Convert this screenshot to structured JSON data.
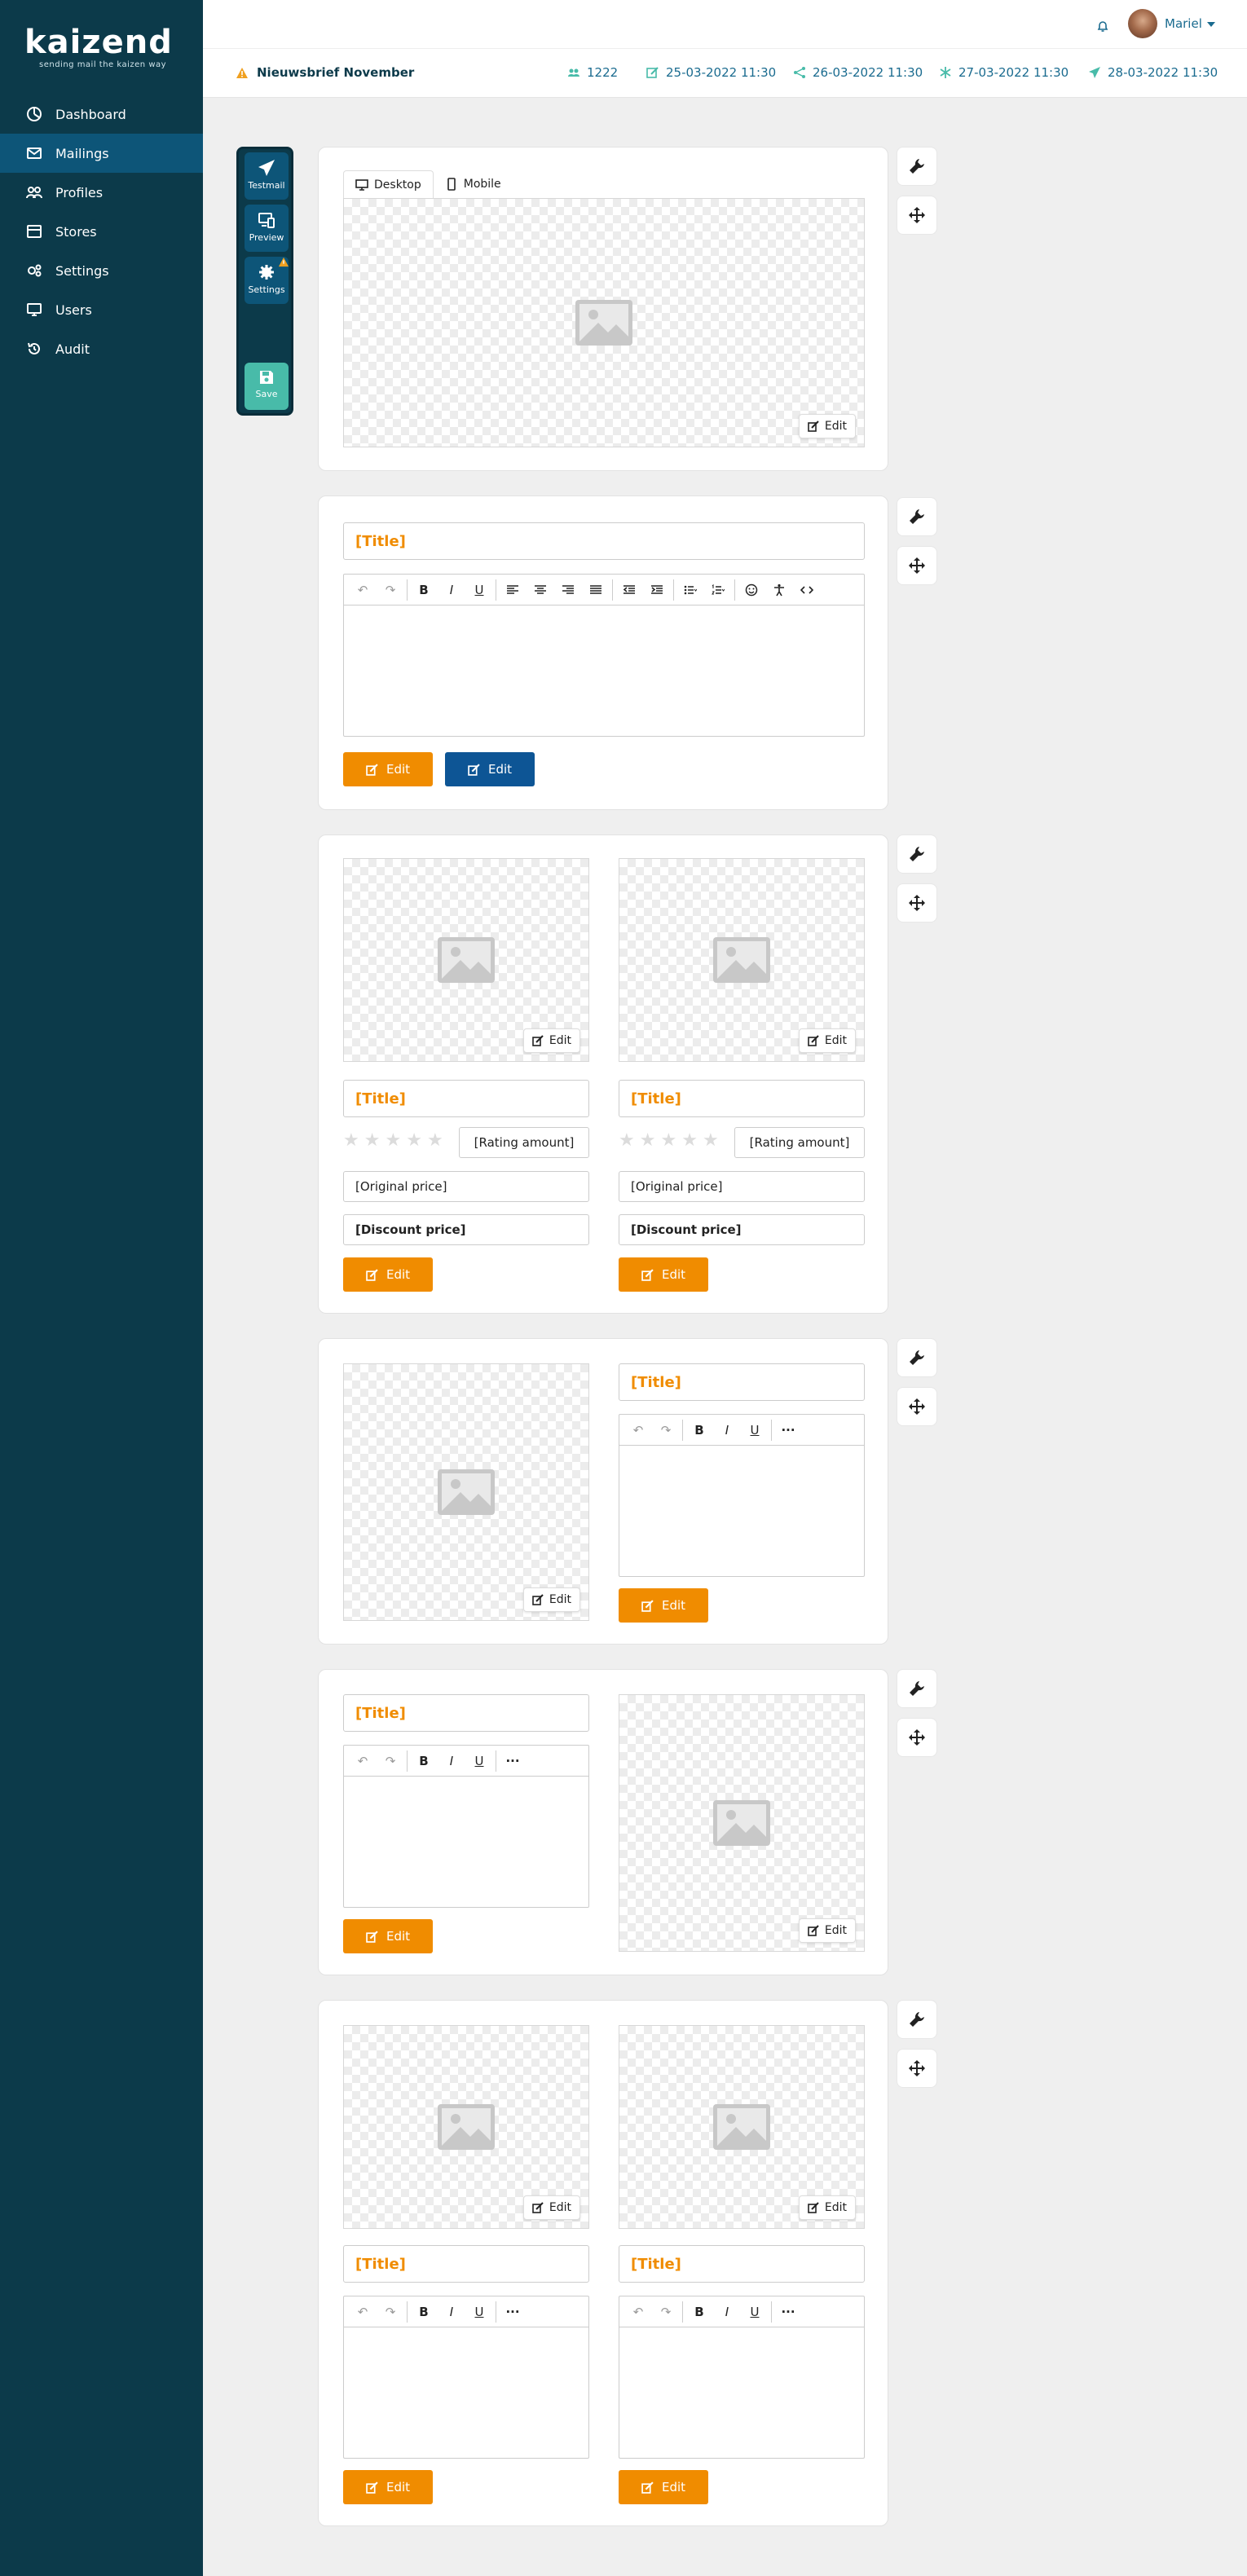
{
  "brand": {
    "name": "kaizend",
    "tagline": "sending mail the kaizen way"
  },
  "sidebar": {
    "items": [
      {
        "label": "Dashboard",
        "icon": "dashboard-icon"
      },
      {
        "label": "Mailings",
        "icon": "mailings-icon",
        "active": true
      },
      {
        "label": "Profiles",
        "icon": "profiles-icon"
      },
      {
        "label": "Stores",
        "icon": "stores-icon"
      },
      {
        "label": "Settings",
        "icon": "settings-icon"
      },
      {
        "label": "Users",
        "icon": "users-icon"
      },
      {
        "label": "Audit",
        "icon": "audit-icon"
      }
    ]
  },
  "header": {
    "user": "Mariel",
    "mailing_title": "Nieuwsbrief November",
    "recipients": "1222",
    "created": "25-03-2022 11:30",
    "shared": "26-03-2022 11:30",
    "scheduled": "27-03-2022 11:30",
    "sent": "28-03-2022 11:30"
  },
  "tool_panel": {
    "testmail": "Testmail",
    "preview": "Preview",
    "settings": "Settings",
    "save": "Save"
  },
  "view_tabs": {
    "desktop": "Desktop",
    "mobile": "Mobile"
  },
  "labels": {
    "edit": "Edit",
    "title": "[Title]",
    "rating_amount": "[Rating amount]",
    "original_price": "[Original price]",
    "discount_price": "[Discount price]"
  },
  "colors": {
    "sidebar": "#0c3a4a",
    "active_nav": "#0d5578",
    "accent_orange": "#f08c00",
    "accent_blue": "#0d5595",
    "save": "#48bba9",
    "link": "#1a6b8f"
  }
}
